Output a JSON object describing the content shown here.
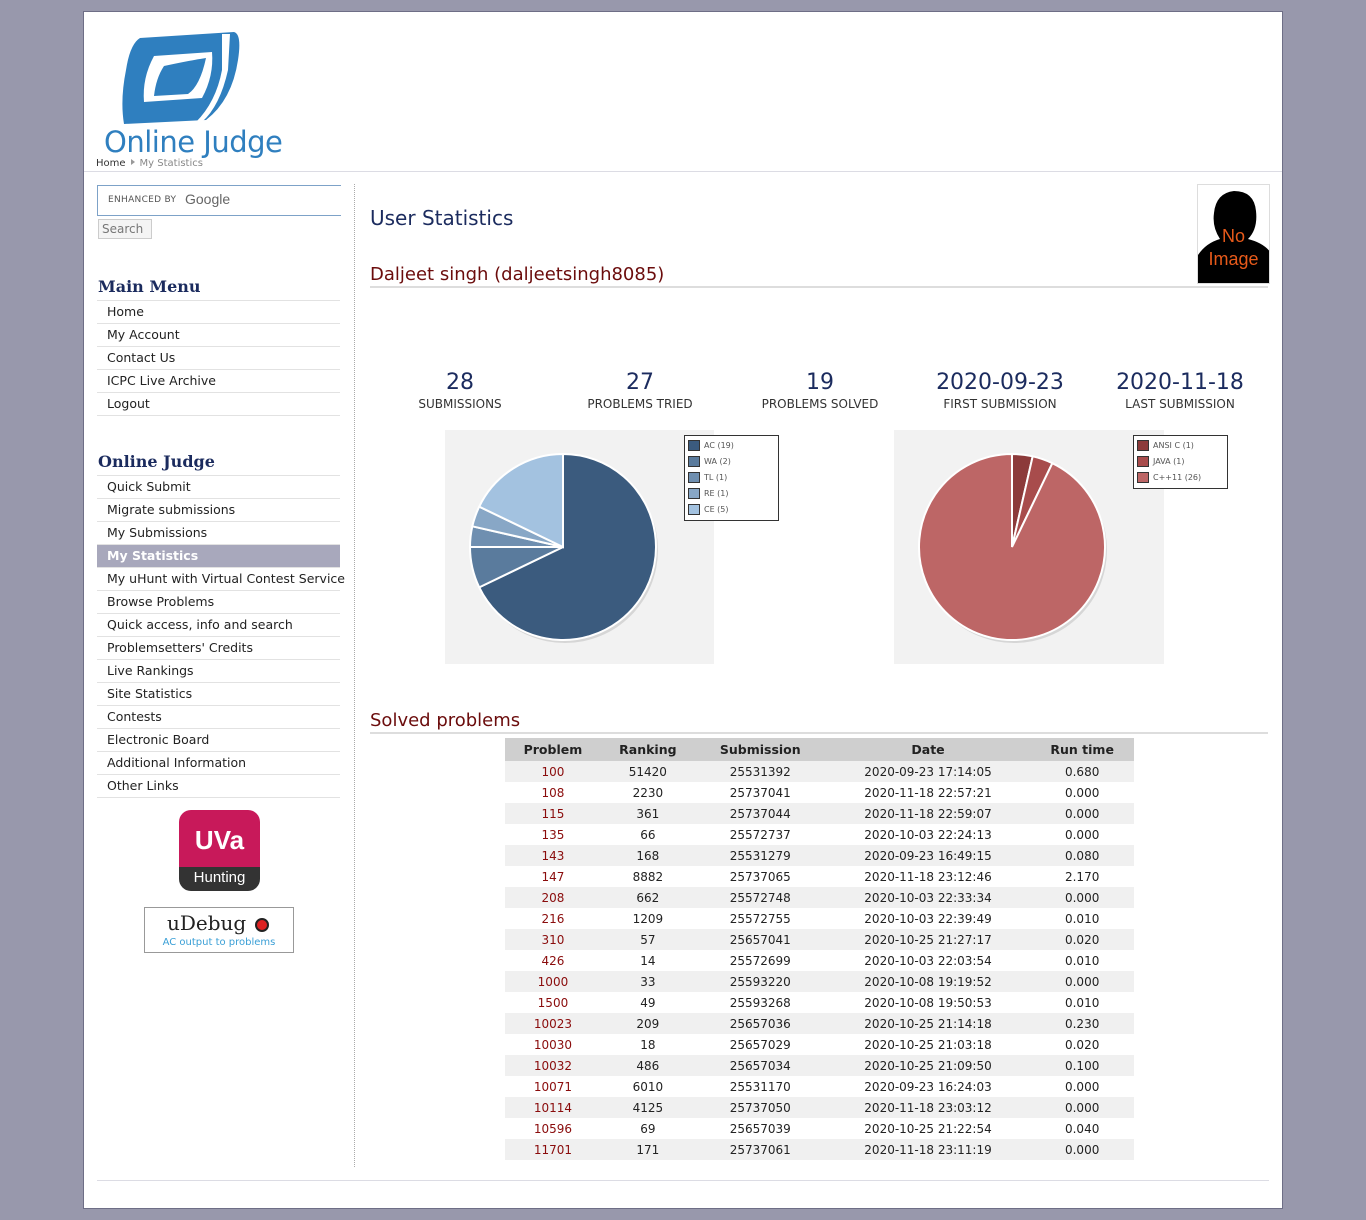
{
  "header": {
    "logo_text": "Online Judge",
    "breadcrumb": [
      "Home",
      "My Statistics"
    ]
  },
  "search": {
    "enhanced_by": "ENHANCED BY",
    "google": "Google",
    "button": "Search"
  },
  "main_menu": {
    "title": "Main Menu",
    "items": [
      "Home",
      "My Account",
      "Contact Us",
      "ICPC Live Archive",
      "Logout"
    ]
  },
  "oj_menu": {
    "title": "Online Judge",
    "items": [
      "Quick Submit",
      "Migrate submissions",
      "My Submissions",
      "My Statistics",
      "My uHunt with Virtual Contest Service",
      "Browse Problems",
      "Quick access, info and search",
      "Problemsetters' Credits",
      "Live Rankings",
      "Site Statistics",
      "Contests",
      "Electronic Board",
      "Additional Information",
      "Other Links"
    ],
    "active": "My Statistics"
  },
  "badges": {
    "uva_top": "UVa",
    "uva_bottom": "Hunting",
    "udebug_title": "uDebug",
    "udebug_sub": "AC output to problems"
  },
  "main": {
    "title": "User Statistics",
    "user": "Daljeet singh (daljeetsingh8085)",
    "avatar_text": [
      "No",
      "Image"
    ]
  },
  "stats": [
    {
      "value": "28",
      "label": "SUBMISSIONS"
    },
    {
      "value": "27",
      "label": "PROBLEMS TRIED"
    },
    {
      "value": "19",
      "label": "PROBLEMS SOLVED"
    },
    {
      "value": "2020-09-23",
      "label": "FIRST SUBMISSION"
    },
    {
      "value": "2020-11-18",
      "label": "LAST SUBMISSION"
    }
  ],
  "chart_data": [
    {
      "type": "pie",
      "title": "",
      "categories": [
        "AC (19)",
        "WA (2)",
        "TL (1)",
        "RE (1)",
        "CE (5)"
      ],
      "values": [
        19,
        2,
        1,
        1,
        5
      ],
      "colors": [
        "#3b5b7e",
        "#5a7b9d",
        "#6f8fb0",
        "#88a7c6",
        "#a3c2e0"
      ],
      "legend": "top-right"
    },
    {
      "type": "pie",
      "title": "",
      "categories": [
        "ANSI C (1)",
        "JAVA (1)",
        "C++11 (26)"
      ],
      "values": [
        1,
        1,
        26
      ],
      "colors": [
        "#8c3a3a",
        "#a84c4c",
        "#bd6666"
      ],
      "legend": "top-right"
    }
  ],
  "solved": {
    "title": "Solved problems",
    "headers": [
      "Problem",
      "Ranking",
      "Submission",
      "Date",
      "Run time"
    ],
    "rows": [
      [
        "100",
        "51420",
        "25531392",
        "2020-09-23 17:14:05",
        "0.680"
      ],
      [
        "108",
        "2230",
        "25737041",
        "2020-11-18 22:57:21",
        "0.000"
      ],
      [
        "115",
        "361",
        "25737044",
        "2020-11-18 22:59:07",
        "0.000"
      ],
      [
        "135",
        "66",
        "25572737",
        "2020-10-03 22:24:13",
        "0.000"
      ],
      [
        "143",
        "168",
        "25531279",
        "2020-09-23 16:49:15",
        "0.080"
      ],
      [
        "147",
        "8882",
        "25737065",
        "2020-11-18 23:12:46",
        "2.170"
      ],
      [
        "208",
        "662",
        "25572748",
        "2020-10-03 22:33:34",
        "0.000"
      ],
      [
        "216",
        "1209",
        "25572755",
        "2020-10-03 22:39:49",
        "0.010"
      ],
      [
        "310",
        "57",
        "25657041",
        "2020-10-25 21:27:17",
        "0.020"
      ],
      [
        "426",
        "14",
        "25572699",
        "2020-10-03 22:03:54",
        "0.010"
      ],
      [
        "1000",
        "33",
        "25593220",
        "2020-10-08 19:19:52",
        "0.000"
      ],
      [
        "1500",
        "49",
        "25593268",
        "2020-10-08 19:50:53",
        "0.010"
      ],
      [
        "10023",
        "209",
        "25657036",
        "2020-10-25 21:14:18",
        "0.230"
      ],
      [
        "10030",
        "18",
        "25657029",
        "2020-10-25 21:03:18",
        "0.020"
      ],
      [
        "10032",
        "486",
        "25657034",
        "2020-10-25 21:09:50",
        "0.100"
      ],
      [
        "10071",
        "6010",
        "25531170",
        "2020-09-23 16:24:03",
        "0.000"
      ],
      [
        "10114",
        "4125",
        "25737050",
        "2020-11-18 23:03:12",
        "0.000"
      ],
      [
        "10596",
        "69",
        "25657039",
        "2020-10-25 21:22:54",
        "0.040"
      ],
      [
        "11701",
        "171",
        "25737061",
        "2020-11-18 23:11:19",
        "0.000"
      ]
    ]
  }
}
